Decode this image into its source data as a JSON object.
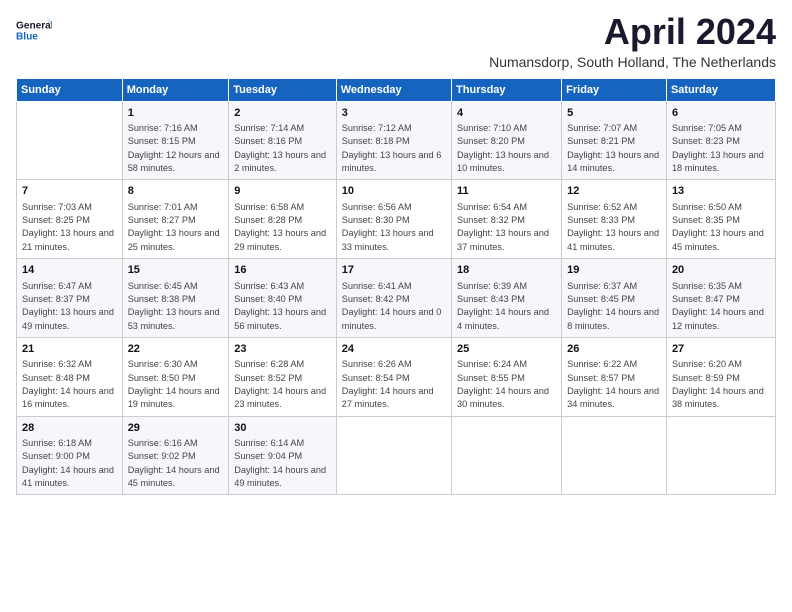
{
  "logo": {
    "line1": "General",
    "line2": "Blue"
  },
  "title": "April 2024",
  "subtitle": "Numansdorp, South Holland, The Netherlands",
  "days": [
    "Sunday",
    "Monday",
    "Tuesday",
    "Wednesday",
    "Thursday",
    "Friday",
    "Saturday"
  ],
  "weeks": [
    [
      {
        "num": "",
        "sunrise": "",
        "sunset": "",
        "daylight": ""
      },
      {
        "num": "1",
        "sunrise": "Sunrise: 7:16 AM",
        "sunset": "Sunset: 8:15 PM",
        "daylight": "Daylight: 12 hours and 58 minutes."
      },
      {
        "num": "2",
        "sunrise": "Sunrise: 7:14 AM",
        "sunset": "Sunset: 8:16 PM",
        "daylight": "Daylight: 13 hours and 2 minutes."
      },
      {
        "num": "3",
        "sunrise": "Sunrise: 7:12 AM",
        "sunset": "Sunset: 8:18 PM",
        "daylight": "Daylight: 13 hours and 6 minutes."
      },
      {
        "num": "4",
        "sunrise": "Sunrise: 7:10 AM",
        "sunset": "Sunset: 8:20 PM",
        "daylight": "Daylight: 13 hours and 10 minutes."
      },
      {
        "num": "5",
        "sunrise": "Sunrise: 7:07 AM",
        "sunset": "Sunset: 8:21 PM",
        "daylight": "Daylight: 13 hours and 14 minutes."
      },
      {
        "num": "6",
        "sunrise": "Sunrise: 7:05 AM",
        "sunset": "Sunset: 8:23 PM",
        "daylight": "Daylight: 13 hours and 18 minutes."
      }
    ],
    [
      {
        "num": "7",
        "sunrise": "Sunrise: 7:03 AM",
        "sunset": "Sunset: 8:25 PM",
        "daylight": "Daylight: 13 hours and 21 minutes."
      },
      {
        "num": "8",
        "sunrise": "Sunrise: 7:01 AM",
        "sunset": "Sunset: 8:27 PM",
        "daylight": "Daylight: 13 hours and 25 minutes."
      },
      {
        "num": "9",
        "sunrise": "Sunrise: 6:58 AM",
        "sunset": "Sunset: 8:28 PM",
        "daylight": "Daylight: 13 hours and 29 minutes."
      },
      {
        "num": "10",
        "sunrise": "Sunrise: 6:56 AM",
        "sunset": "Sunset: 8:30 PM",
        "daylight": "Daylight: 13 hours and 33 minutes."
      },
      {
        "num": "11",
        "sunrise": "Sunrise: 6:54 AM",
        "sunset": "Sunset: 8:32 PM",
        "daylight": "Daylight: 13 hours and 37 minutes."
      },
      {
        "num": "12",
        "sunrise": "Sunrise: 6:52 AM",
        "sunset": "Sunset: 8:33 PM",
        "daylight": "Daylight: 13 hours and 41 minutes."
      },
      {
        "num": "13",
        "sunrise": "Sunrise: 6:50 AM",
        "sunset": "Sunset: 8:35 PM",
        "daylight": "Daylight: 13 hours and 45 minutes."
      }
    ],
    [
      {
        "num": "14",
        "sunrise": "Sunrise: 6:47 AM",
        "sunset": "Sunset: 8:37 PM",
        "daylight": "Daylight: 13 hours and 49 minutes."
      },
      {
        "num": "15",
        "sunrise": "Sunrise: 6:45 AM",
        "sunset": "Sunset: 8:38 PM",
        "daylight": "Daylight: 13 hours and 53 minutes."
      },
      {
        "num": "16",
        "sunrise": "Sunrise: 6:43 AM",
        "sunset": "Sunset: 8:40 PM",
        "daylight": "Daylight: 13 hours and 56 minutes."
      },
      {
        "num": "17",
        "sunrise": "Sunrise: 6:41 AM",
        "sunset": "Sunset: 8:42 PM",
        "daylight": "Daylight: 14 hours and 0 minutes."
      },
      {
        "num": "18",
        "sunrise": "Sunrise: 6:39 AM",
        "sunset": "Sunset: 8:43 PM",
        "daylight": "Daylight: 14 hours and 4 minutes."
      },
      {
        "num": "19",
        "sunrise": "Sunrise: 6:37 AM",
        "sunset": "Sunset: 8:45 PM",
        "daylight": "Daylight: 14 hours and 8 minutes."
      },
      {
        "num": "20",
        "sunrise": "Sunrise: 6:35 AM",
        "sunset": "Sunset: 8:47 PM",
        "daylight": "Daylight: 14 hours and 12 minutes."
      }
    ],
    [
      {
        "num": "21",
        "sunrise": "Sunrise: 6:32 AM",
        "sunset": "Sunset: 8:48 PM",
        "daylight": "Daylight: 14 hours and 16 minutes."
      },
      {
        "num": "22",
        "sunrise": "Sunrise: 6:30 AM",
        "sunset": "Sunset: 8:50 PM",
        "daylight": "Daylight: 14 hours and 19 minutes."
      },
      {
        "num": "23",
        "sunrise": "Sunrise: 6:28 AM",
        "sunset": "Sunset: 8:52 PM",
        "daylight": "Daylight: 14 hours and 23 minutes."
      },
      {
        "num": "24",
        "sunrise": "Sunrise: 6:26 AM",
        "sunset": "Sunset: 8:54 PM",
        "daylight": "Daylight: 14 hours and 27 minutes."
      },
      {
        "num": "25",
        "sunrise": "Sunrise: 6:24 AM",
        "sunset": "Sunset: 8:55 PM",
        "daylight": "Daylight: 14 hours and 30 minutes."
      },
      {
        "num": "26",
        "sunrise": "Sunrise: 6:22 AM",
        "sunset": "Sunset: 8:57 PM",
        "daylight": "Daylight: 14 hours and 34 minutes."
      },
      {
        "num": "27",
        "sunrise": "Sunrise: 6:20 AM",
        "sunset": "Sunset: 8:59 PM",
        "daylight": "Daylight: 14 hours and 38 minutes."
      }
    ],
    [
      {
        "num": "28",
        "sunrise": "Sunrise: 6:18 AM",
        "sunset": "Sunset: 9:00 PM",
        "daylight": "Daylight: 14 hours and 41 minutes."
      },
      {
        "num": "29",
        "sunrise": "Sunrise: 6:16 AM",
        "sunset": "Sunset: 9:02 PM",
        "daylight": "Daylight: 14 hours and 45 minutes."
      },
      {
        "num": "30",
        "sunrise": "Sunrise: 6:14 AM",
        "sunset": "Sunset: 9:04 PM",
        "daylight": "Daylight: 14 hours and 49 minutes."
      },
      {
        "num": "",
        "sunrise": "",
        "sunset": "",
        "daylight": ""
      },
      {
        "num": "",
        "sunrise": "",
        "sunset": "",
        "daylight": ""
      },
      {
        "num": "",
        "sunrise": "",
        "sunset": "",
        "daylight": ""
      },
      {
        "num": "",
        "sunrise": "",
        "sunset": "",
        "daylight": ""
      }
    ]
  ]
}
